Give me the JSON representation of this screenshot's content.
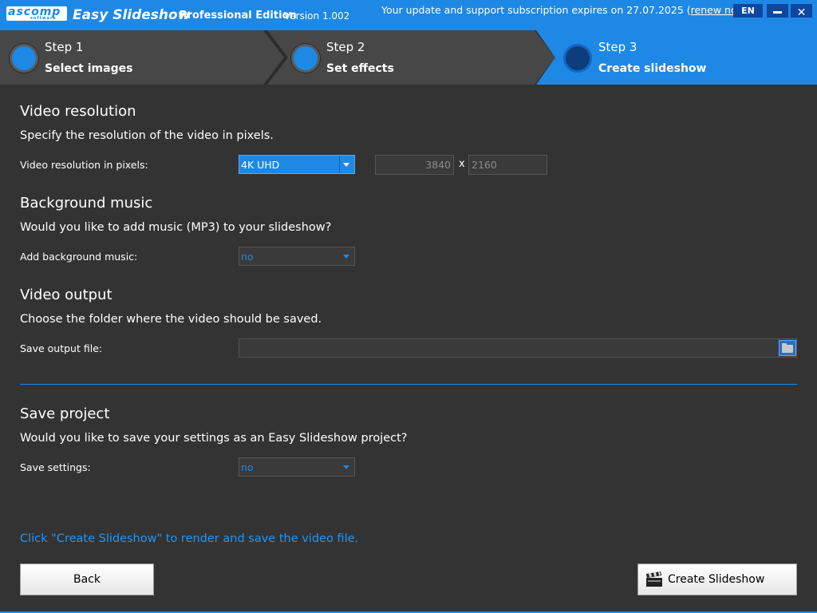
{
  "titlebar": {
    "logo_text": "ascomp",
    "logo_sub": "software",
    "app_name": "Easy Slideshow",
    "edition": "Professional Edition",
    "version": "Version 1.002",
    "subscription_text": "Your update and support subscription expires on 27.07.2025",
    "renew_prefix": "(",
    "renew_link": "renew now",
    "renew_suffix": ")",
    "language": "EN",
    "close_symbol": "✕"
  },
  "steps": [
    {
      "number": "Step 1",
      "label": "Select images"
    },
    {
      "number": "Step 2",
      "label": "Set effects"
    },
    {
      "number": "Step 3",
      "label": "Create slideshow"
    }
  ],
  "resolution": {
    "title": "Video resolution",
    "description": "Specify the resolution of the video in pixels.",
    "field_label": "Video resolution in pixels:",
    "selected": "4K UHD",
    "width": "3840",
    "times": "x",
    "height": "2160"
  },
  "music": {
    "title": "Background music",
    "description": "Would you like to add music (MP3) to your slideshow?",
    "field_label": "Add background music:",
    "selected": "no"
  },
  "output": {
    "title": "Video output",
    "description": "Choose the folder where the video should be saved.",
    "field_label": "Save output file:",
    "value": ""
  },
  "project": {
    "title": "Save project",
    "description": "Would you like to save your settings as an Easy Slideshow project?",
    "field_label": "Save settings:",
    "selected": "no"
  },
  "hint": "Click \"Create Slideshow\" to render and save the video file.",
  "buttons": {
    "back": "Back",
    "create": "Create Slideshow"
  },
  "colors": {
    "accent": "#1e88e5",
    "background": "#333333",
    "step_bar": "#404040"
  }
}
